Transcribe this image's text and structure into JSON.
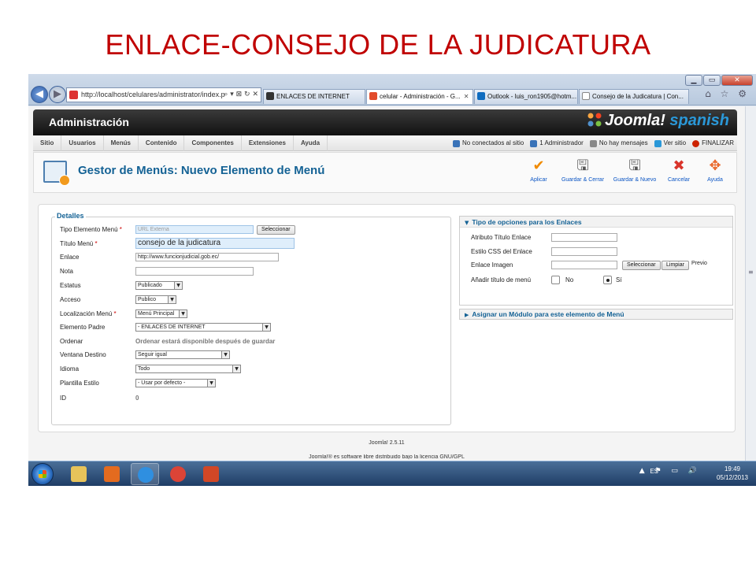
{
  "slide": {
    "title": "ENLACE-CONSEJO DE LA JUDICATURA"
  },
  "browser": {
    "address": "http://localhost/celulares/administrator/index.p",
    "address_host": "localhost",
    "address_controls": "⌕ ▾ ⊠ ↻ ✕",
    "window_buttons": {
      "minimize": "▁",
      "maximize": "▭",
      "close": "✕"
    },
    "tabs": [
      {
        "label": "ENLACES DE INTERNET",
        "icon_color": "#333333",
        "active": false
      },
      {
        "label": "celular - Administración - G...",
        "icon_color": "#e24b2b",
        "active": true,
        "close": "✕"
      },
      {
        "label": "Outlook - luis_ron1905@hotm...",
        "icon_color": "#0f6cc0",
        "active": false
      },
      {
        "label": "Consejo de la Judicatura | Con...",
        "icon_color": "#ffffff",
        "active": false
      }
    ],
    "right_icons": "⌂ ☆ ⚙"
  },
  "admin": {
    "title": "Administración",
    "brand_main": "Joomla!",
    "brand_sub": "spanish",
    "menu": [
      "Sitio",
      "Usuarios",
      "Menús",
      "Contenido",
      "Componentes",
      "Extensiones",
      "Ayuda"
    ],
    "status": [
      {
        "label": "No conectados al sitio",
        "color": "#3a73b8"
      },
      {
        "label": "1 Administrador",
        "color": "#3a73b8"
      },
      {
        "label": "No hay mensajes",
        "color": "#888888"
      },
      {
        "label": "Ver sitio",
        "color": "#2a98d8"
      },
      {
        "label": "FINALIZAR",
        "color": "#cc2200"
      }
    ]
  },
  "toolbar": {
    "title": "Gestor de Menús: Nuevo Elemento de Menú",
    "buttons": [
      {
        "label": "Aplicar",
        "icon": "✔",
        "color": "#f08a00"
      },
      {
        "label": "Guardar & Cerrar",
        "icon": "🖫",
        "color": "#555555"
      },
      {
        "label": "Guardar & Nuevo",
        "icon": "🖫",
        "color": "#555555"
      },
      {
        "label": "Cancelar",
        "icon": "✖",
        "color": "#d9342b"
      },
      {
        "label": "Ayuda",
        "icon": "✥",
        "color": "#e9682b"
      }
    ]
  },
  "details": {
    "legend": "Detalles",
    "required_mark": "*",
    "tipo_label": "Tipo Elemento Menú",
    "tipo_value": "URL Externa",
    "tipo_button": "Seleccionar",
    "titulo_label": "Título Menú",
    "titulo_value": "consejo de la judicatura",
    "enlace_label": "Enlace",
    "enlace_value": "http://www.funcionjudicial.gob.ec/",
    "nota_label": "Nota",
    "nota_value": "",
    "estatus_label": "Estatus",
    "estatus_value": "Publicado",
    "acceso_label": "Acceso",
    "acceso_value": "Publico",
    "localizacion_label": "Localización Menú",
    "localizacion_value": "Menú Principal",
    "padre_label": "Elemento Padre",
    "padre_value": "- ENLACES DE INTERNET",
    "ordenar_label": "Ordenar",
    "ordenar_value": "Ordenar estará disponible después de guardar",
    "ventana_label": "Ventana Destino",
    "ventana_value": "Seguir igual",
    "idioma_label": "Idioma",
    "idioma_value": "Todo",
    "plantilla_label": "Plantilla Estilo",
    "plantilla_value": "- Usar por defecto -",
    "id_label": "ID",
    "id_value": "0",
    "caret": "▼"
  },
  "link_options": {
    "heading": "Tipo de opciones para los Enlaces",
    "arrow": "▼",
    "atributo_label": "Atributo Título Enlace",
    "estilo_label": "Estilo CSS del Enlace",
    "imagen_label": "Enlace Imagen",
    "select_button": "Seleccionar",
    "clear_button": "Limpiar",
    "preview_label": "Previo",
    "anadir_label": "Añadir título de menú",
    "no_label": "No",
    "si_label": "Sí",
    "anadir_selected": "Sí"
  },
  "module_panel": {
    "heading": "Asignar un Módulo para este elemento de Menú",
    "arrow": "▶"
  },
  "footer": {
    "version": "Joomla! 2.5.11",
    "license": "Joomla!® es software libre distribuido bajo la licencia GNU/GPL"
  },
  "taskbar": {
    "apps": [
      {
        "name": "explorer",
        "color": "#e7c35a"
      },
      {
        "name": "media-player",
        "color": "#e46b1f"
      },
      {
        "name": "internet-explorer",
        "color": "#2f8fe0"
      },
      {
        "name": "chrome",
        "color": "#db4437"
      },
      {
        "name": "powerpoint",
        "color": "#d24726"
      }
    ],
    "language": "ES",
    "tray_icons": "▲ ⚑ ▭ 🔊",
    "time": "19:49",
    "date": "05/12/2013"
  }
}
